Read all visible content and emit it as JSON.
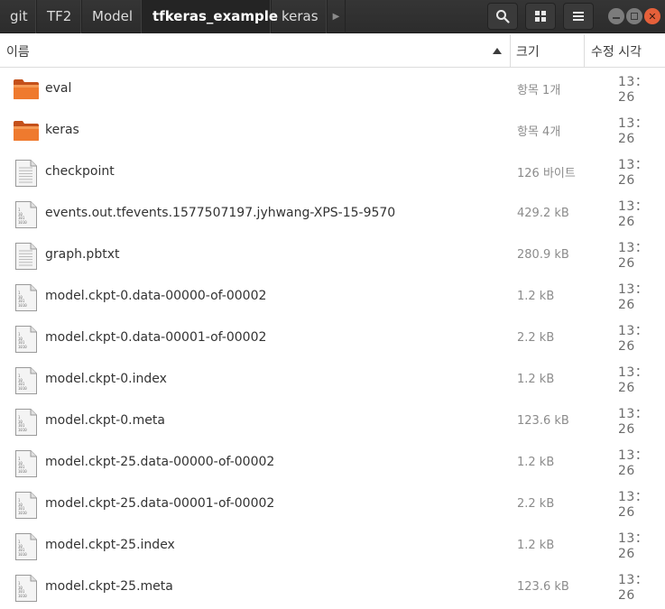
{
  "breadcrumbs": [
    {
      "label": "git"
    },
    {
      "label": "TF2"
    },
    {
      "label": "Model"
    },
    {
      "label": "tfkeras_example"
    },
    {
      "label": "keras"
    }
  ],
  "active_crumb": "tfkeras_example",
  "header_icons": {
    "search": "search-icon",
    "view": "grid-view-icon",
    "menu": "hamburger-menu-icon",
    "minimize": "minimize-icon",
    "maximize": "maximize-icon",
    "close": "close-icon"
  },
  "columns": {
    "name": "이름",
    "size": "크기",
    "modified": "수정 시각"
  },
  "files": [
    {
      "name": "eval",
      "size": "항목 1개",
      "time": "13：26",
      "kind": "folder"
    },
    {
      "name": "keras",
      "size": "항목 4개",
      "time": "13：26",
      "kind": "folder"
    },
    {
      "name": "checkpoint",
      "size": "126 바이트",
      "time": "13：26",
      "kind": "text"
    },
    {
      "name": "events.out.tfevents.1577507197.jyhwang-XPS-15-9570",
      "size": "429.2 kB",
      "time": "13：26",
      "kind": "binary"
    },
    {
      "name": "graph.pbtxt",
      "size": "280.9 kB",
      "time": "13：26",
      "kind": "text"
    },
    {
      "name": "model.ckpt-0.data-00000-of-00002",
      "size": "1.2 kB",
      "time": "13：26",
      "kind": "binary"
    },
    {
      "name": "model.ckpt-0.data-00001-of-00002",
      "size": "2.2 kB",
      "time": "13：26",
      "kind": "binary"
    },
    {
      "name": "model.ckpt-0.index",
      "size": "1.2 kB",
      "time": "13：26",
      "kind": "binary"
    },
    {
      "name": "model.ckpt-0.meta",
      "size": "123.6 kB",
      "time": "13：26",
      "kind": "binary"
    },
    {
      "name": "model.ckpt-25.data-00000-of-00002",
      "size": "1.2 kB",
      "time": "13：26",
      "kind": "binary"
    },
    {
      "name": "model.ckpt-25.data-00001-of-00002",
      "size": "2.2 kB",
      "time": "13：26",
      "kind": "binary"
    },
    {
      "name": "model.ckpt-25.index",
      "size": "1.2 kB",
      "time": "13：26",
      "kind": "binary"
    },
    {
      "name": "model.ckpt-25.meta",
      "size": "123.6 kB",
      "time": "13：26",
      "kind": "binary"
    }
  ],
  "binary_icon_lines": [
    "1",
    "10",
    "101",
    "1010"
  ],
  "colors": {
    "header_bg": "#2c2c2c",
    "folder_orange": "#e8671f",
    "close_button": "#e5603a"
  }
}
